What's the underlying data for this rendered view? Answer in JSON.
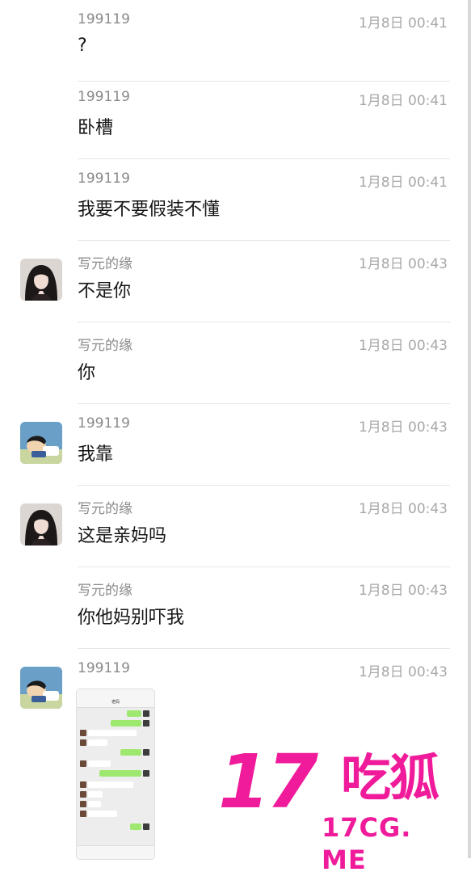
{
  "messages": [
    {
      "sender": "199119",
      "time": "1月8日 00:41",
      "text": "?"
    },
    {
      "sender": "199119",
      "time": "1月8日 00:41",
      "text": "卧槽"
    },
    {
      "sender": "199119",
      "time": "1月8日 00:41",
      "text": "我要不要假装不懂"
    },
    {
      "sender": "写元的缘",
      "time": "1月8日 00:43",
      "text": "不是你"
    },
    {
      "sender": "写元的缘",
      "time": "1月8日 00:43",
      "text": "你"
    },
    {
      "sender": "199119",
      "time": "1月8日 00:43",
      "text": "我靠"
    },
    {
      "sender": "写元的缘",
      "time": "1月8日 00:43",
      "text": "这是亲妈吗"
    },
    {
      "sender": "写元的缘",
      "time": "1月8日 00:43",
      "text": "你他妈别吓我"
    },
    {
      "sender": "199119",
      "time": "1月8日 00:43",
      "text": ""
    }
  ],
  "thumbnail": {
    "title": "老妈"
  },
  "watermark": {
    "number": "17",
    "name": "吃狐",
    "url": "17CG. ME"
  },
  "colors": {
    "watermark": "#f01b9a",
    "time": "#a8a8a8",
    "sender": "#8a8a8a"
  }
}
